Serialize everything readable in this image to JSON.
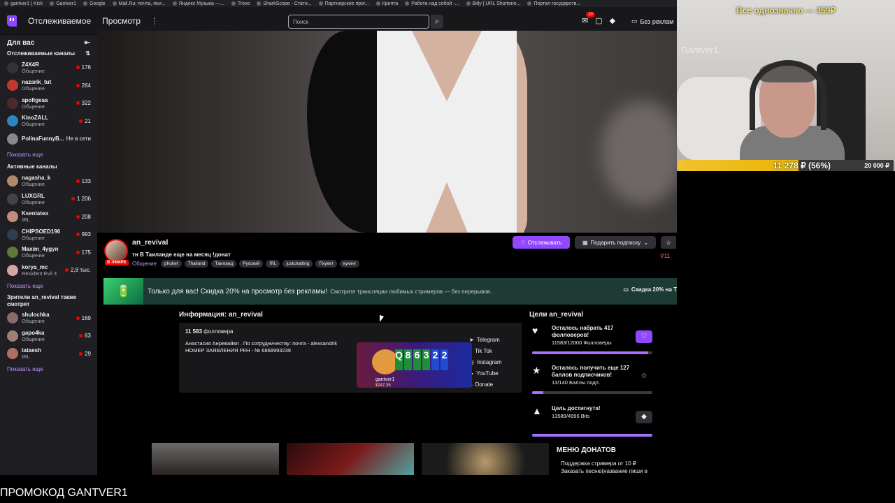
{
  "bookmarks": [
    "gantver1 | Kick",
    "Gantver1",
    "Google",
    "Mail.Ru: почта, пои...",
    "Яндекс Музыка —...",
    "Trovo",
    "SharkScope - Стати...",
    "Партнерские прог...",
    "Крипта",
    "Работа над собой -...",
    "Bitly | URL Shortene...",
    "Портал государств..."
  ],
  "nav": {
    "following": "Отслеживаемое",
    "browse": "Просмотр",
    "more": "⋮",
    "search_placeholder": "Поиск",
    "inbox_count": "10",
    "adfree": "Без реклам"
  },
  "sidebar": {
    "title": "Для вас",
    "followed_title": "Отслеживаемые каналы",
    "followed": [
      {
        "name": "Z4X4R",
        "cat": "Общение",
        "count": "176",
        "color": "#333"
      },
      {
        "name": "nazarik_tut",
        "cat": "Общение",
        "count": "264",
        "color": "#c0392b"
      },
      {
        "name": "apofigeaa",
        "cat": "Общение",
        "count": "322",
        "color": "#4a2a2a"
      },
      {
        "name": "KinoZALL",
        "cat": "Общение",
        "count": "21",
        "color": "#2e86c1"
      },
      {
        "name": "PolinaFunnyB...",
        "cat": "",
        "count": "Не в сети",
        "color": "#888"
      }
    ],
    "show_more_1": "Показать еще",
    "active_title": "Активные каналы",
    "active": [
      {
        "name": "nagasha_k",
        "cat": "Общение",
        "count": "133",
        "color": "#b08a6a"
      },
      {
        "name": "LUXGRL",
        "cat": "Общение",
        "count": "1 206",
        "color": "#444"
      },
      {
        "name": "Kseniatea",
        "cat": "IRL",
        "count": "208",
        "color": "#c48a7a"
      },
      {
        "name": "CHIPSOED196",
        "cat": "Общение",
        "count": "993",
        "color": "#2c3e50"
      },
      {
        "name": "Maxim_4ygyn",
        "cat": "Общение",
        "count": "175",
        "color": "#5c7a3a"
      },
      {
        "name": "korya_mc",
        "cat": "Resident Evil 3",
        "count": "2,8 тыс.",
        "color": "#d4a5a5"
      }
    ],
    "show_more_2": "Показать еще",
    "also_title": "Зрители an_revival также смотрят",
    "also": [
      {
        "name": "shulochka",
        "cat": "Общение",
        "count": "169",
        "color": "#8a6a6a"
      },
      {
        "name": "gapo4ka",
        "cat": "Общение",
        "count": "63",
        "color": "#a08070"
      },
      {
        "name": "tataesh",
        "cat": "IRL",
        "count": "29",
        "color": "#b07060"
      }
    ],
    "show_more_3": "Показать еще"
  },
  "channel": {
    "name": "an_revival",
    "live": "В ЭФИРЕ",
    "title": "тн В Таиланде еще на месяц !донат",
    "category": "Общение",
    "tags": [
      "phuket",
      "Thailand",
      "Таиланд",
      "Русский",
      "IRL",
      "justchatting",
      "Пхукет",
      "кукинг"
    ],
    "follow": "Отслеживать",
    "gift": "Подарить подписку",
    "viewers": "11"
  },
  "promo": {
    "main": "Только для вас! Скидка 20% на просмотр без рекламы!",
    "sub": "Смотрите трансляции любимых стримеров — без перерывов.",
    "right": "Скидка 20% на Т"
  },
  "about": {
    "heading": "Информация: an_revival",
    "followers_num": "11 583",
    "followers_label": "фолловера",
    "bio1": "Анастасия Анревайвл . По сотрудничеству: почта - alexsandrik",
    "bio2": "НОМЕР ЗАЯВЛЕНИЯ РКН - № 6868993239",
    "social": [
      "Telegram",
      "Tik Tok",
      "Instagram",
      "YouTube",
      "Donate"
    ]
  },
  "widget": {
    "cards": [
      "Q",
      "8",
      "6",
      "3",
      "2",
      "2"
    ],
    "name": "gantver1",
    "amount": "$247.35"
  },
  "goals": {
    "heading": "Цели an_revival",
    "items": [
      {
        "title": "Осталось набрать 417 фолловеров!",
        "sub": "11583/12000 Фолловеры",
        "progress": 0.965
      },
      {
        "title": "Осталось получить еще 127 баллов подписчиков!",
        "sub": "13/140 Баллы подп.",
        "progress": 0.093
      },
      {
        "title": "Цель достигнута!",
        "sub": "13589/4996 Bits",
        "progress": 1.0
      }
    ]
  },
  "donations": {
    "heading": "МЕНЮ ДОНАТОВ",
    "text": "Поддержка стримера от 10 ₽ Заказать песню(название пиши в"
  },
  "cam": {
    "title": "Все однозначно — 359₽",
    "watermark": "Gantver1",
    "amount": "11 278 ₽ (56%)",
    "goal": "20 000 ₽",
    "progress": 0.56
  },
  "promo_code": "ПРОМОКОД GANTVER1"
}
